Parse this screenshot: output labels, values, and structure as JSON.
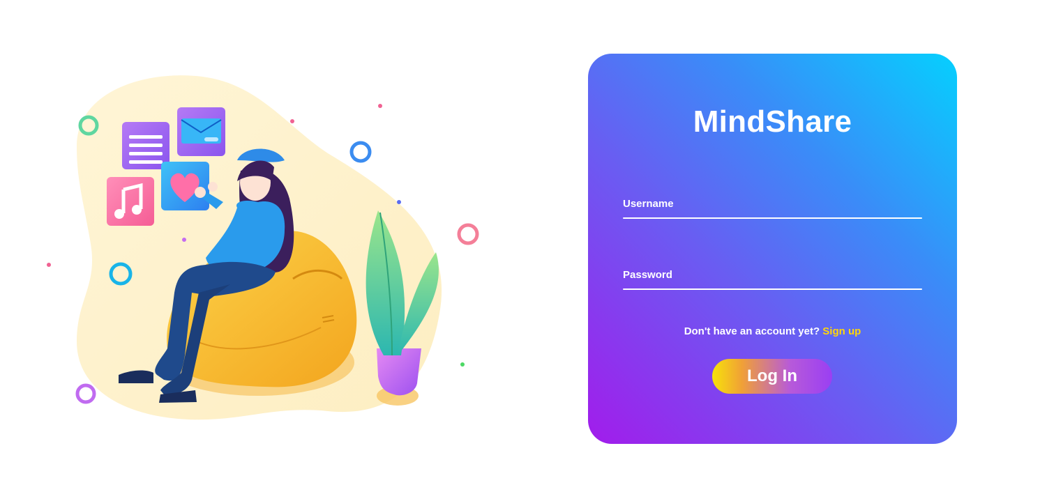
{
  "app": {
    "title": "MindShare"
  },
  "login": {
    "username_label": "Username",
    "username_value": "",
    "password_label": "Password",
    "password_value": "",
    "signup_prompt": "Don't have an account yet?",
    "signup_link": "Sign up",
    "submit_label": "Log In"
  },
  "colors": {
    "card_gradient": [
      "#05d0fe",
      "#3a8cf8",
      "#6a5cf2",
      "#a21ceb"
    ],
    "button_gradient": [
      "#f7e20a",
      "#f0a037",
      "#b75ad9",
      "#9a3ff3"
    ],
    "link": "#ffd60a",
    "text": "#ffffff"
  },
  "illustration": {
    "subject": "woman-on-beanbag-with-phone",
    "icons": [
      "document-icon",
      "mail-icon",
      "heart-icon",
      "music-icon"
    ]
  }
}
